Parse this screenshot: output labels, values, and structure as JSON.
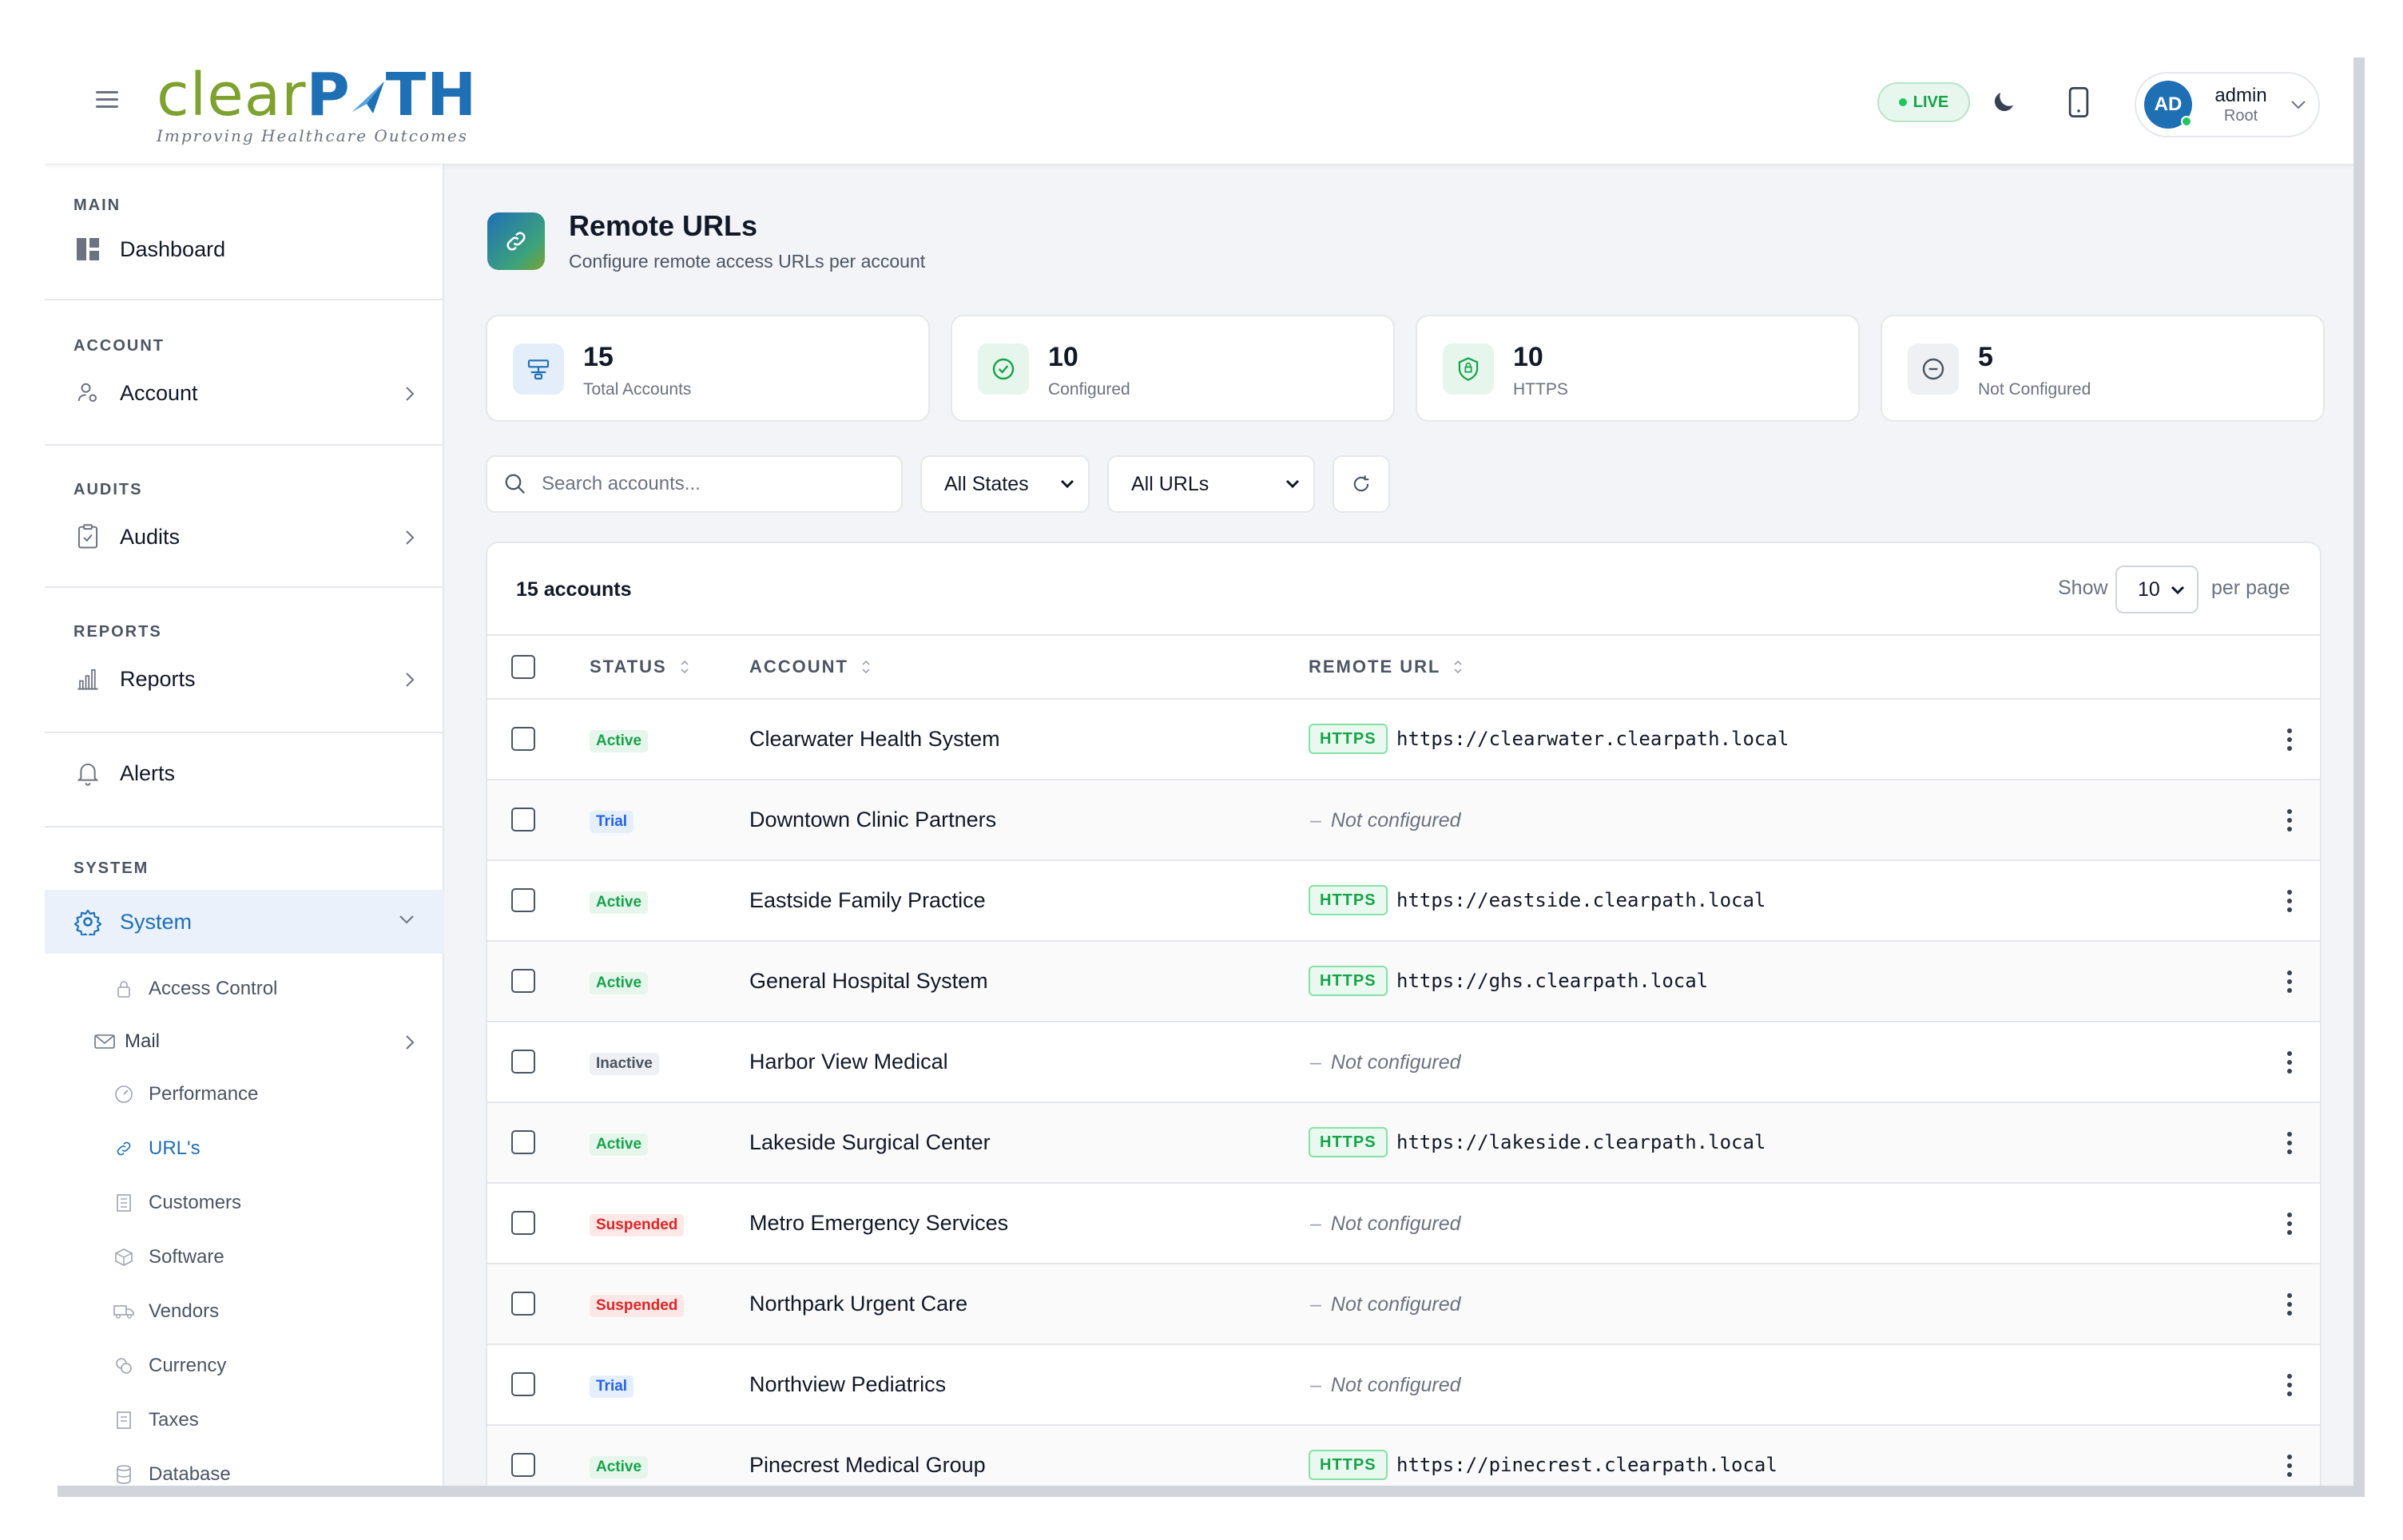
{
  "header": {
    "logo_main_a": "clear",
    "logo_main_b": "P",
    "logo_main_c": "TH",
    "logo_tagline": "Improving Healthcare Outcomes",
    "live_label": "LIVE",
    "user": {
      "initials": "AD",
      "name": "admin",
      "role": "Root"
    }
  },
  "sidebar": {
    "main_label": "MAIN",
    "dashboard": "Dashboard",
    "account_section": "ACCOUNT",
    "account": "Account",
    "audits_section": "AUDITS",
    "audits": "Audits",
    "reports_section": "REPORTS",
    "reports": "Reports",
    "alerts": "Alerts",
    "system_section": "SYSTEM",
    "system": "System",
    "sub_items": [
      "Access Control",
      "Mail",
      "Performance",
      "URL's",
      "Customers",
      "Software",
      "Vendors",
      "Currency",
      "Taxes",
      "Database"
    ]
  },
  "page": {
    "title": "Remote URLs",
    "subtitle": "Configure remote access URLs per account"
  },
  "stats": [
    {
      "value": "15",
      "label": "Total Accounts"
    },
    {
      "value": "10",
      "label": "Configured"
    },
    {
      "value": "10",
      "label": "HTTPS"
    },
    {
      "value": "5",
      "label": "Not Configured"
    }
  ],
  "filters": {
    "search_placeholder": "Search accounts...",
    "state_select": "All States",
    "url_select": "All URLs"
  },
  "table": {
    "count_label": "15 accounts",
    "show_label": "Show",
    "per_page_value": "10",
    "per_page_label": "per page",
    "columns": {
      "status": "STATUS",
      "account": "ACCOUNT",
      "remote_url": "REMOTE URL"
    },
    "https_label": "HTTPS",
    "not_configured_label": "Not configured",
    "rows": [
      {
        "status": "Active",
        "account": "Clearwater Health System",
        "url": "https://clearwater.clearpath.local"
      },
      {
        "status": "Trial",
        "account": "Downtown Clinic Partners",
        "url": ""
      },
      {
        "status": "Active",
        "account": "Eastside Family Practice",
        "url": "https://eastside.clearpath.local"
      },
      {
        "status": "Active",
        "account": "General Hospital System",
        "url": "https://ghs.clearpath.local"
      },
      {
        "status": "Inactive",
        "account": "Harbor View Medical",
        "url": ""
      },
      {
        "status": "Active",
        "account": "Lakeside Surgical Center",
        "url": "https://lakeside.clearpath.local"
      },
      {
        "status": "Suspended",
        "account": "Metro Emergency Services",
        "url": ""
      },
      {
        "status": "Suspended",
        "account": "Northpark Urgent Care",
        "url": ""
      },
      {
        "status": "Trial",
        "account": "Northview Pediatrics",
        "url": ""
      },
      {
        "status": "Active",
        "account": "Pinecrest Medical Group",
        "url": "https://pinecrest.clearpath.local"
      }
    ]
  },
  "colors": {
    "brand_blue": "#1f6fb5",
    "brand_green": "#7ea12f",
    "success": "#16a34a",
    "danger": "#dc2626",
    "info": "#2563eb"
  }
}
